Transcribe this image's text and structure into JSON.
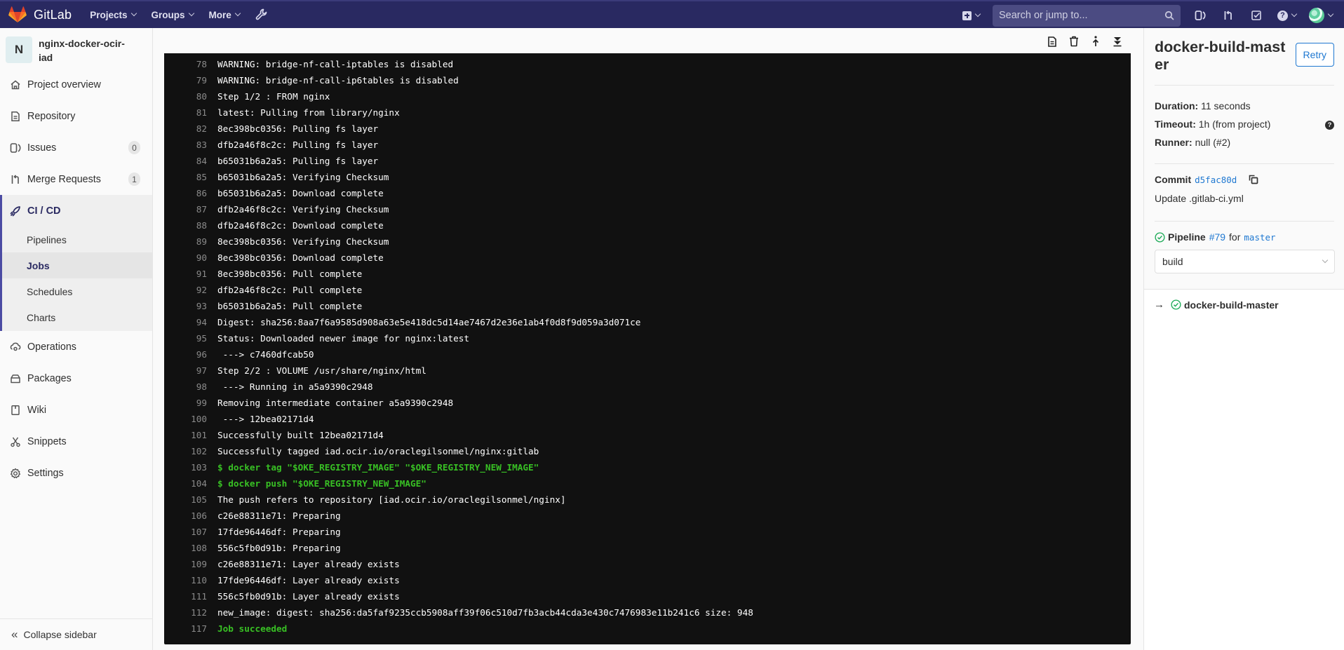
{
  "navbar": {
    "brand": "GitLab",
    "menu": [
      {
        "label": "Projects",
        "icon": "chevron-down-icon"
      },
      {
        "label": "Groups",
        "icon": "chevron-down-icon"
      },
      {
        "label": "More",
        "icon": "chevron-down-icon"
      }
    ],
    "admin_icon": "wrench-icon",
    "search_placeholder": "Search or jump to...",
    "right_icons": [
      "new-item-icon",
      "issues-icon",
      "merge-requests-icon",
      "todos-icon",
      "help-icon",
      "user-avatar"
    ]
  },
  "sidebar": {
    "project_initial": "N",
    "project_name": "nginx-docker-ocir-iad",
    "items": [
      {
        "label": "Project overview",
        "icon": "home-icon"
      },
      {
        "label": "Repository",
        "icon": "document-icon"
      },
      {
        "label": "Issues",
        "icon": "issues-icon",
        "badge": "0"
      },
      {
        "label": "Merge Requests",
        "icon": "merge-request-icon",
        "badge": "1"
      },
      {
        "label": "CI / CD",
        "icon": "rocket-icon",
        "active": true
      },
      {
        "label": "Operations",
        "icon": "cloud-gear-icon"
      },
      {
        "label": "Packages",
        "icon": "package-icon"
      },
      {
        "label": "Wiki",
        "icon": "book-icon"
      },
      {
        "label": "Snippets",
        "icon": "scissors-icon"
      },
      {
        "label": "Settings",
        "icon": "gear-icon"
      }
    ],
    "cicd_subitems": [
      {
        "label": "Pipelines"
      },
      {
        "label": "Jobs",
        "active": true
      },
      {
        "label": "Schedules"
      },
      {
        "label": "Charts"
      }
    ],
    "collapse_label": "Collapse sidebar"
  },
  "log_toolbar": {
    "buttons": [
      "raw-log-icon",
      "erase-log-icon",
      "scroll-top-icon",
      "scroll-bottom-icon"
    ]
  },
  "log": {
    "lines": [
      {
        "n": "78",
        "text": "WARNING: bridge-nf-call-iptables is disabled",
        "style": "normal"
      },
      {
        "n": "79",
        "text": "WARNING: bridge-nf-call-ip6tables is disabled",
        "style": "normal"
      },
      {
        "n": "80",
        "text": "Step 1/2 : FROM nginx",
        "style": "normal"
      },
      {
        "n": "81",
        "text": "latest: Pulling from library/nginx",
        "style": "normal"
      },
      {
        "n": "82",
        "text": "8ec398bc0356: Pulling fs layer",
        "style": "normal"
      },
      {
        "n": "83",
        "text": "dfb2a46f8c2c: Pulling fs layer",
        "style": "normal"
      },
      {
        "n": "84",
        "text": "b65031b6a2a5: Pulling fs layer",
        "style": "normal"
      },
      {
        "n": "85",
        "text": "b65031b6a2a5: Verifying Checksum",
        "style": "normal"
      },
      {
        "n": "86",
        "text": "b65031b6a2a5: Download complete",
        "style": "normal"
      },
      {
        "n": "87",
        "text": "dfb2a46f8c2c: Verifying Checksum",
        "style": "normal"
      },
      {
        "n": "88",
        "text": "dfb2a46f8c2c: Download complete",
        "style": "normal"
      },
      {
        "n": "89",
        "text": "8ec398bc0356: Verifying Checksum",
        "style": "normal"
      },
      {
        "n": "90",
        "text": "8ec398bc0356: Download complete",
        "style": "normal"
      },
      {
        "n": "91",
        "text": "8ec398bc0356: Pull complete",
        "style": "normal"
      },
      {
        "n": "92",
        "text": "dfb2a46f8c2c: Pull complete",
        "style": "normal"
      },
      {
        "n": "93",
        "text": "b65031b6a2a5: Pull complete",
        "style": "normal"
      },
      {
        "n": "94",
        "text": "Digest: sha256:8aa7f6a9585d908a63e5e418dc5d14ae7467d2e36e1ab4f0d8f9d059a3d071ce",
        "style": "normal"
      },
      {
        "n": "95",
        "text": "Status: Downloaded newer image for nginx:latest",
        "style": "normal"
      },
      {
        "n": "96",
        "text": " ---> c7460dfcab50",
        "style": "normal"
      },
      {
        "n": "97",
        "text": "Step 2/2 : VOLUME /usr/share/nginx/html",
        "style": "normal"
      },
      {
        "n": "98",
        "text": " ---> Running in a5a9390c2948",
        "style": "normal"
      },
      {
        "n": "99",
        "text": "Removing intermediate container a5a9390c2948",
        "style": "normal"
      },
      {
        "n": "100",
        "text": " ---> 12bea02171d4",
        "style": "normal"
      },
      {
        "n": "101",
        "text": "Successfully built 12bea02171d4",
        "style": "normal"
      },
      {
        "n": "102",
        "text": "Successfully tagged iad.ocir.io/oraclegilsonmel/nginx:gitlab",
        "style": "normal"
      },
      {
        "n": "103",
        "text": "$ docker tag \"$OKE_REGISTRY_IMAGE\" \"$OKE_REGISTRY_NEW_IMAGE\"",
        "style": "cmd"
      },
      {
        "n": "104",
        "text": "$ docker push \"$OKE_REGISTRY_NEW_IMAGE\"",
        "style": "cmd"
      },
      {
        "n": "105",
        "text": "The push refers to repository [iad.ocir.io/oraclegilsonmel/nginx]",
        "style": "normal"
      },
      {
        "n": "106",
        "text": "c26e88311e71: Preparing",
        "style": "normal"
      },
      {
        "n": "107",
        "text": "17fde96446df: Preparing",
        "style": "normal"
      },
      {
        "n": "108",
        "text": "556c5fb0d91b: Preparing",
        "style": "normal"
      },
      {
        "n": "109",
        "text": "c26e88311e71: Layer already exists",
        "style": "normal"
      },
      {
        "n": "110",
        "text": "17fde96446df: Layer already exists",
        "style": "normal"
      },
      {
        "n": "111",
        "text": "556c5fb0d91b: Layer already exists",
        "style": "normal"
      },
      {
        "n": "112",
        "text": "new_image: digest: sha256:da5faf9235ccb5908aff39f06c510d7fb3acb44cda3e430c7476983e11b241c6 size: 948",
        "style": "normal"
      },
      {
        "n": "117",
        "text": "Job succeeded",
        "style": "ok"
      }
    ]
  },
  "job": {
    "title": "docker-build-master",
    "retry_label": "Retry",
    "duration_label": "Duration:",
    "duration_value": "11 seconds",
    "timeout_label": "Timeout:",
    "timeout_value": "1h (from project)",
    "runner_label": "Runner:",
    "runner_value": "null (#2)",
    "commit_label": "Commit",
    "commit_sha": "d5fac80d",
    "commit_message": "Update .gitlab-ci.yml",
    "pipeline_label": "Pipeline",
    "pipeline_id": "#79",
    "pipeline_for": "for",
    "pipeline_ref": "master",
    "pipeline_status": "passed",
    "stage_selected": "build",
    "jobs": [
      {
        "name": "docker-build-master",
        "status": "passed",
        "current": true
      }
    ]
  },
  "colors": {
    "navbar": "#292961",
    "accent": "#4b4ba3",
    "link": "#1f78d1",
    "success": "#38c024",
    "log_bg": "#111111"
  }
}
